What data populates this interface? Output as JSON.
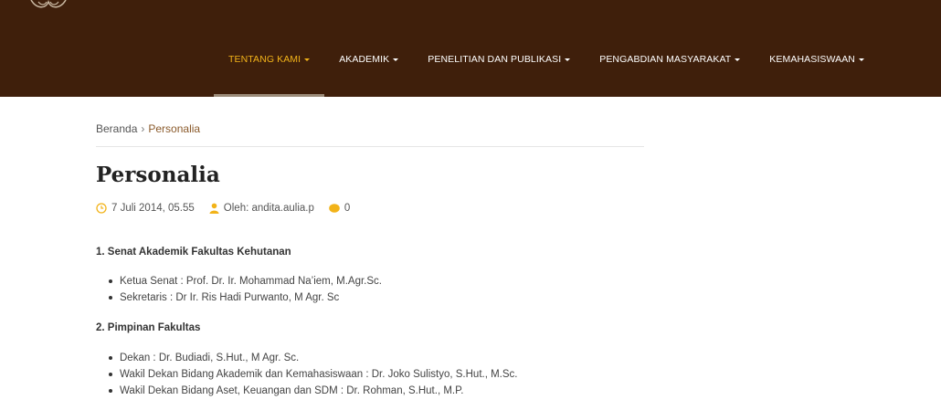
{
  "nav": {
    "items": [
      {
        "label": "TENTANG KAMI",
        "active": true
      },
      {
        "label": "AKADEMIK",
        "active": false
      },
      {
        "label": "PENELITIAN DAN PUBLIKASI",
        "active": false
      },
      {
        "label": "PENGABDIAN MASYARAKAT",
        "active": false
      },
      {
        "label": "KEMAHASISWAAN",
        "active": false
      }
    ]
  },
  "breadcrumb": {
    "home": "Beranda",
    "separator": "›",
    "current": "Personalia"
  },
  "post": {
    "title": "Personalia",
    "date": "7 Juli 2014, 05.55",
    "author": "Oleh: andita.aulia.p",
    "comments": "0"
  },
  "sections": [
    {
      "heading": "1. Senat Akademik Fakultas Kehutanan",
      "items": [
        "Ketua Senat : Prof. Dr. Ir. Mohammad Na’iem, M.Agr.Sc.",
        "Sekretaris :  Dr Ir. Ris Hadi Purwanto, M Agr. Sc"
      ]
    },
    {
      "heading": "2. Pimpinan Fakultas",
      "items": [
        "Dekan : Dr. Budiadi, S.Hut., M Agr. Sc.",
        "Wakil Dekan Bidang Akademik dan Kemahasiswaan : Dr. Joko Sulistyo, S.Hut., M.Sc.",
        "Wakil Dekan Bidang Aset, Keuangan dan SDM : Dr. Rohman, S.Hut., M.P."
      ]
    }
  ],
  "colors": {
    "header_bg": "#3f1f0b",
    "accent": "#f2b319",
    "link": "#8a5a2b"
  },
  "icons": {
    "date": "clock-icon",
    "author": "user-icon",
    "comments": "comment-icon"
  }
}
